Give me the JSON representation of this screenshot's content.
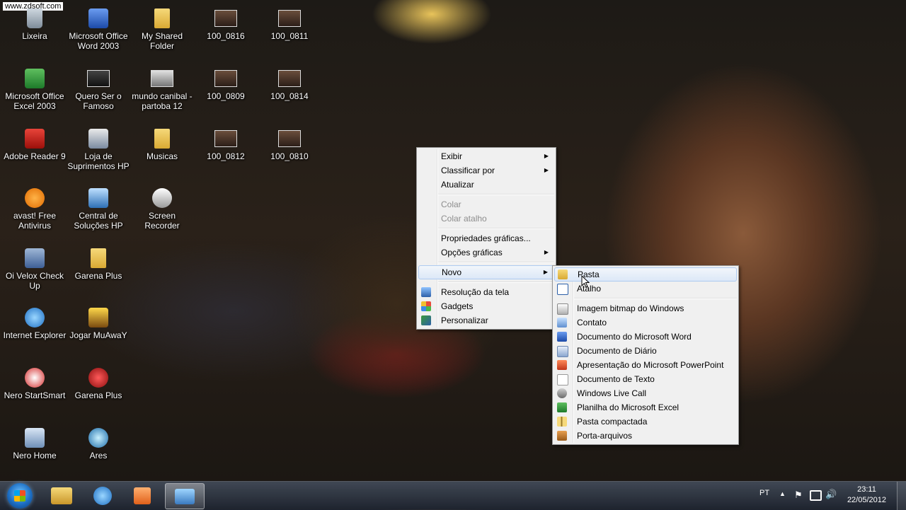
{
  "watermark": "www.zdsoft.com",
  "desktop_icons": [
    {
      "label": "Lixeira",
      "icon": "recycle-bin-icon"
    },
    {
      "label": "Microsoft Office Word 2003",
      "icon": "word-icon"
    },
    {
      "label": "My Shared Folder",
      "icon": "folder-icon"
    },
    {
      "label": "100_0816",
      "icon": "photo-thumbnail-icon"
    },
    {
      "label": "100_0811",
      "icon": "photo-thumbnail-icon"
    },
    {
      "label": "Microsoft Office Excel 2003",
      "icon": "excel-icon"
    },
    {
      "label": "Quero Ser o Famoso",
      "icon": "video-thumbnail-icon"
    },
    {
      "label": "mundo canibal - partoba 12",
      "icon": "video-thumbnail-icon"
    },
    {
      "label": "100_0809",
      "icon": "photo-thumbnail-icon"
    },
    {
      "label": "100_0814",
      "icon": "photo-thumbnail-icon"
    },
    {
      "label": "Adobe Reader 9",
      "icon": "adobe-reader-icon"
    },
    {
      "label": "Loja de Suprimentos HP",
      "icon": "hp-store-icon"
    },
    {
      "label": "Musicas",
      "icon": "folder-icon"
    },
    {
      "label": "100_0812",
      "icon": "photo-thumbnail-icon"
    },
    {
      "label": "100_0810",
      "icon": "photo-thumbnail-icon"
    },
    {
      "label": "avast! Free Antivirus",
      "icon": "avast-icon"
    },
    {
      "label": "Central de Soluções HP",
      "icon": "hp-solution-center-icon"
    },
    {
      "label": "Screen Recorder",
      "icon": "screen-recorder-icon"
    },
    {
      "label": "Oi Velox Check Up",
      "icon": "oi-velox-icon"
    },
    {
      "label": "Garena Plus",
      "icon": "folder-icon"
    },
    {
      "label": "Internet Explorer",
      "icon": "internet-explorer-icon"
    },
    {
      "label": "Jogar MuAwaY",
      "icon": "muaway-icon"
    },
    {
      "label": "Nero StartSmart",
      "icon": "nero-icon"
    },
    {
      "label": "Garena Plus",
      "icon": "garena-icon"
    },
    {
      "label": "Nero Home",
      "icon": "nero-home-icon"
    },
    {
      "label": "Ares",
      "icon": "ares-icon"
    }
  ],
  "context_menu": {
    "items": [
      {
        "label": "Exibir",
        "submenu": true
      },
      {
        "label": "Classificar por",
        "submenu": true
      },
      {
        "label": "Atualizar"
      },
      {
        "label": "Colar",
        "disabled": true
      },
      {
        "label": "Colar atalho",
        "disabled": true
      },
      {
        "label": "Propriedades gráficas..."
      },
      {
        "label": "Opções gráficas",
        "submenu": true
      },
      {
        "label": "Novo",
        "submenu": true,
        "highlighted": true
      },
      {
        "label": "Resolução da tela",
        "icon": "display-icon"
      },
      {
        "label": "Gadgets",
        "icon": "gadgets-icon"
      },
      {
        "label": "Personalizar",
        "icon": "personalize-icon"
      }
    ]
  },
  "new_submenu": {
    "items": [
      {
        "label": "Pasta",
        "icon": "folder-icon",
        "highlighted": true
      },
      {
        "label": "Atalho",
        "icon": "shortcut-icon"
      },
      {
        "label": "Imagem bitmap do Windows",
        "icon": "bitmap-icon"
      },
      {
        "label": "Contato",
        "icon": "contact-icon"
      },
      {
        "label": "Documento do Microsoft Word",
        "icon": "word-doc-icon"
      },
      {
        "label": "Documento de Diário",
        "icon": "journal-icon"
      },
      {
        "label": "Apresentação do Microsoft PowerPoint",
        "icon": "powerpoint-icon"
      },
      {
        "label": "Documento de Texto",
        "icon": "text-doc-icon"
      },
      {
        "label": "Windows Live Call",
        "icon": "live-call-icon"
      },
      {
        "label": "Planilha do Microsoft Excel",
        "icon": "excel-sheet-icon"
      },
      {
        "label": "Pasta compactada",
        "icon": "zip-folder-icon"
      },
      {
        "label": "Porta-arquivos",
        "icon": "briefcase-icon"
      }
    ]
  },
  "taskbar": {
    "language": "PT",
    "time": "23:11",
    "date": "22/05/2012",
    "pinned": [
      "explorer-icon",
      "internet-explorer-icon",
      "media-player-icon",
      "network-app-icon"
    ]
  },
  "colors": {
    "menu_bg": "#f0f0f0",
    "menu_highlight": "#dce8f7",
    "taskbar": "#1e2430"
  }
}
